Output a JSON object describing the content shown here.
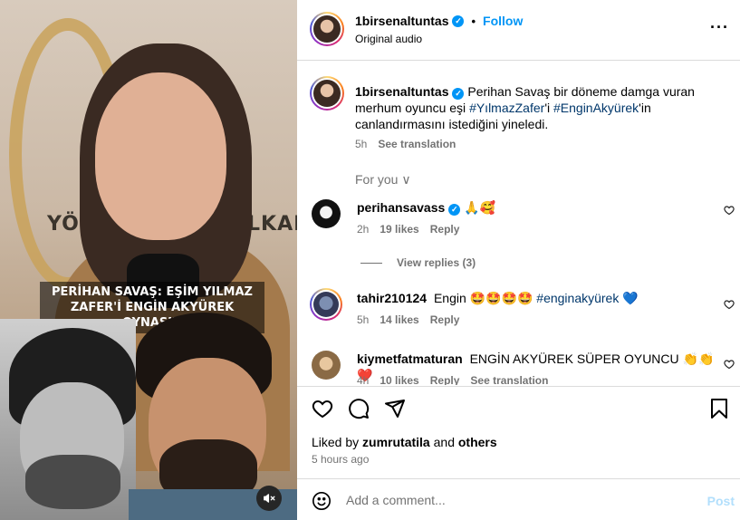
{
  "post": {
    "username": "1birsenaltuntas",
    "follow_label": "Follow",
    "dot": "•",
    "audio_label": "Original audio",
    "more_label": "···",
    "video_overlay_caption": "PERİHAN SAVAŞ: EŞİM YILMAZ ZAFER'İ ENGİN AKYÜREK OYNASIN"
  },
  "caption": {
    "username": "1birsenaltuntas",
    "text_a": "Perihan Savaş bir döneme damga vuran merhum oyuncu eşi",
    "tag_a": "#YılmazZafer",
    "text_b": "'i",
    "tag_b": "#EnginAkyürek",
    "text_c": "'in canlandırmasını istediğini yineledi.",
    "time": "5h",
    "see_translation": "See translation"
  },
  "for_you": "For you ∨",
  "comments": [
    {
      "username": "perihansavass",
      "text": "🙏🥰",
      "time": "2h",
      "likes": "19 likes",
      "reply": "Reply"
    },
    {
      "username": "tahir210124",
      "text": "Engin 🤩🤩🤩🤩",
      "tag": "#enginakyürek",
      "trail": "💙",
      "time": "5h",
      "likes": "14 likes",
      "reply": "Reply"
    },
    {
      "username": "kiymetfatmaturan",
      "text": "ENGİN AKYÜREK SÜPER OYUNCU 👏👏❤️",
      "time": "4h",
      "likes": "10 likes",
      "reply": "Reply",
      "see_translation": "See translation"
    }
  ],
  "view_replies": "View replies (3)",
  "likes_line": {
    "prefix": "Liked by",
    "user": "zumrutatila",
    "mid": "and",
    "others": "others"
  },
  "time_ago": "5 hours ago",
  "add_comment": {
    "placeholder": "Add a comment...",
    "post_label": "Post"
  },
  "colors": {
    "accent": "#0095f6",
    "link": "#00376b",
    "muted": "#737373",
    "post_disabled": "#b2dffc"
  },
  "icons": [
    "mute-icon",
    "verified-icon",
    "more-icon",
    "heart-icon",
    "comment-icon",
    "share-icon",
    "bookmark-icon",
    "emoji-icon"
  ]
}
